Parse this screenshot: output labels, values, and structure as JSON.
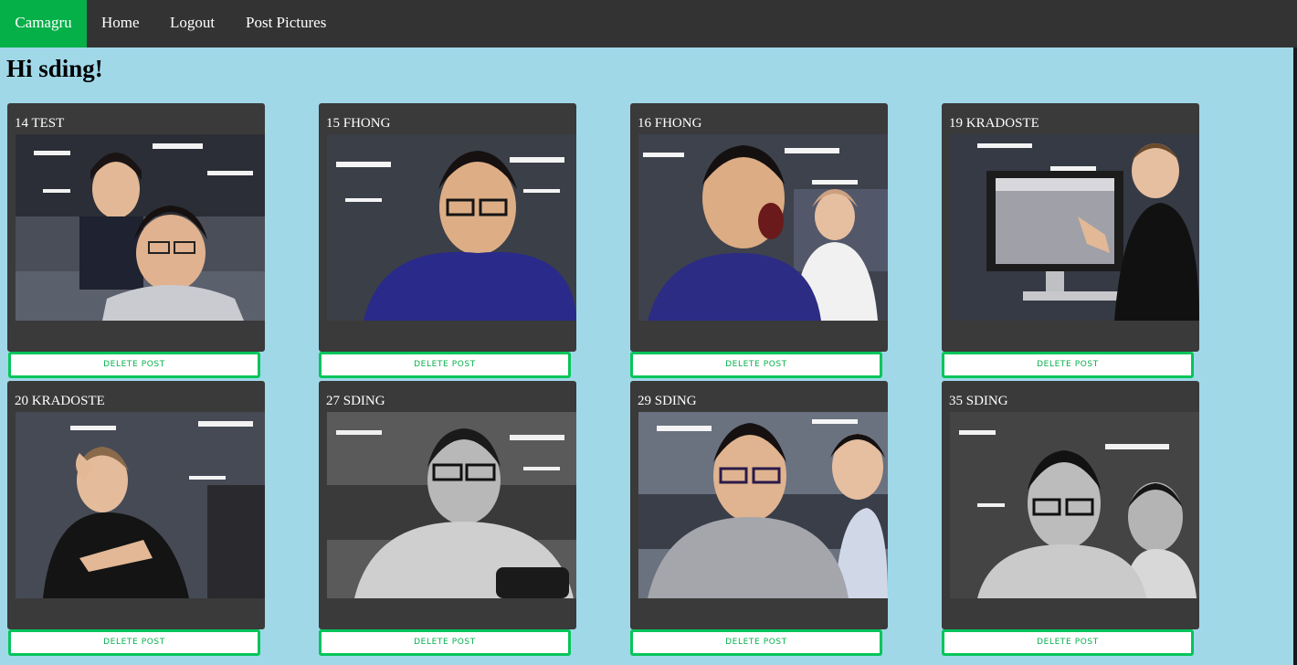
{
  "navbar": {
    "brand": "Camagru",
    "links": [
      "Home",
      "Logout",
      "Post Pictures"
    ],
    "brand_color": "#05b049",
    "bg_color": "#333333"
  },
  "greeting": "Hi sding!",
  "delete_label": "DELETE POST",
  "posts": [
    {
      "title": "14 test",
      "tone": "color"
    },
    {
      "title": "15 fhong",
      "tone": "color"
    },
    {
      "title": "16 fhong",
      "tone": "color"
    },
    {
      "title": "19 kradoste",
      "tone": "color"
    },
    {
      "title": "20 kradoste",
      "tone": "color"
    },
    {
      "title": "27 sding",
      "tone": "grayscale"
    },
    {
      "title": "29 sding",
      "tone": "color"
    },
    {
      "title": "35 sding",
      "tone": "grayscale"
    }
  ],
  "colors": {
    "page_bg": "#a0d8e8",
    "card_bg": "#3a3a3a",
    "button_border": "#06c55a",
    "button_text": "#06b04e"
  }
}
